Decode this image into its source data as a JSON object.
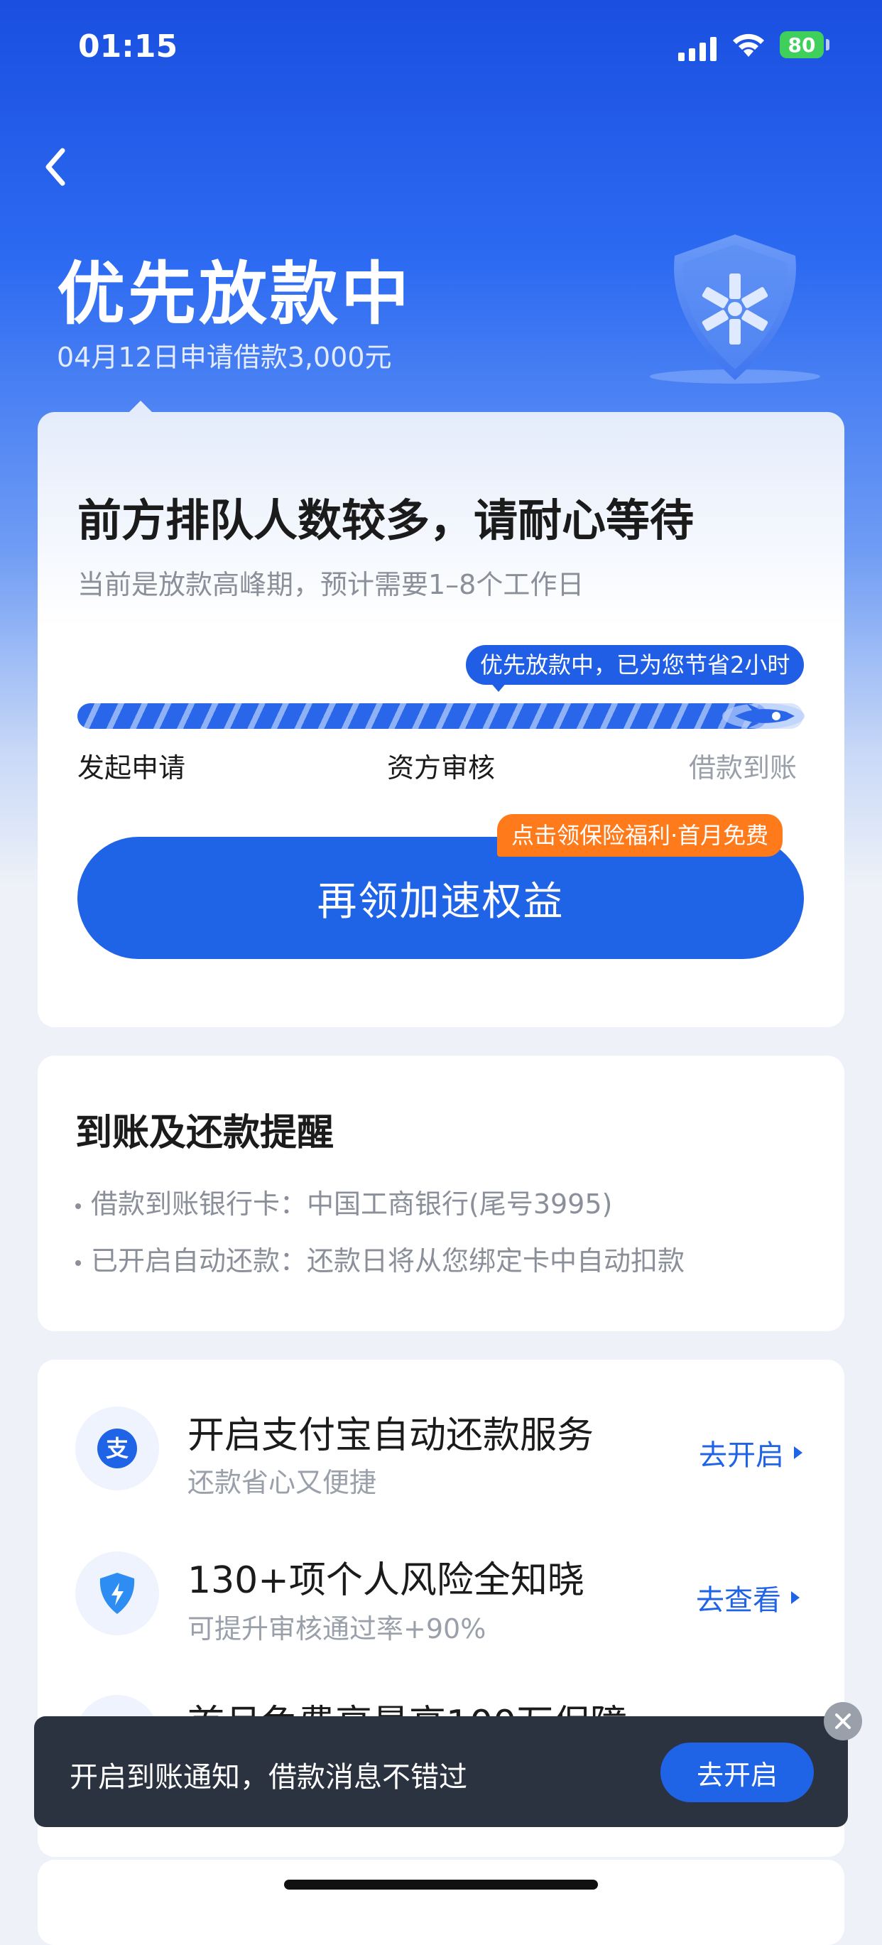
{
  "status_bar": {
    "time": "01:15",
    "battery": "80"
  },
  "header": {
    "title": "优先放款中",
    "subtitle": "04月12日申请借款3,000元"
  },
  "status_card": {
    "heading": "前方排队人数较多，请耐心等待",
    "subheading": "当前是放款高峰期，预计需要1–8个工作日",
    "progress_bubble": "优先放款中，已为您节省2小时",
    "progress_fraction": 0.95,
    "steps": [
      "发起申请",
      "资方审核",
      "借款到账"
    ],
    "accelerate_button": "再领加速权益",
    "promo_tag": "点击领保险福利·首月免费"
  },
  "reminder_card": {
    "title": "到账及还款提醒",
    "items": [
      "借款到账银行卡：中国工商银行(尾号3995)",
      "已开启自动还款：还款日将从您绑定卡中自动扣款"
    ]
  },
  "services": [
    {
      "title": "开启支付宝自动还款服务",
      "subtitle": "还款省心又便捷",
      "link": "去开启",
      "icon": "alipay-icon"
    },
    {
      "title": "130+项个人风险全知晓",
      "subtitle": "可提升审核通过率+90%",
      "link": "去查看",
      "icon": "shield-bolt-icon"
    },
    {
      "title": "首月免费享最高100万保障"
    }
  ],
  "toast": {
    "text": "开启到账通知，借款消息不错过",
    "button": "去开启"
  },
  "colors": {
    "primary": "#1f63e6",
    "promo": "#ff7a1a",
    "toast_bg": "#2b3340"
  }
}
